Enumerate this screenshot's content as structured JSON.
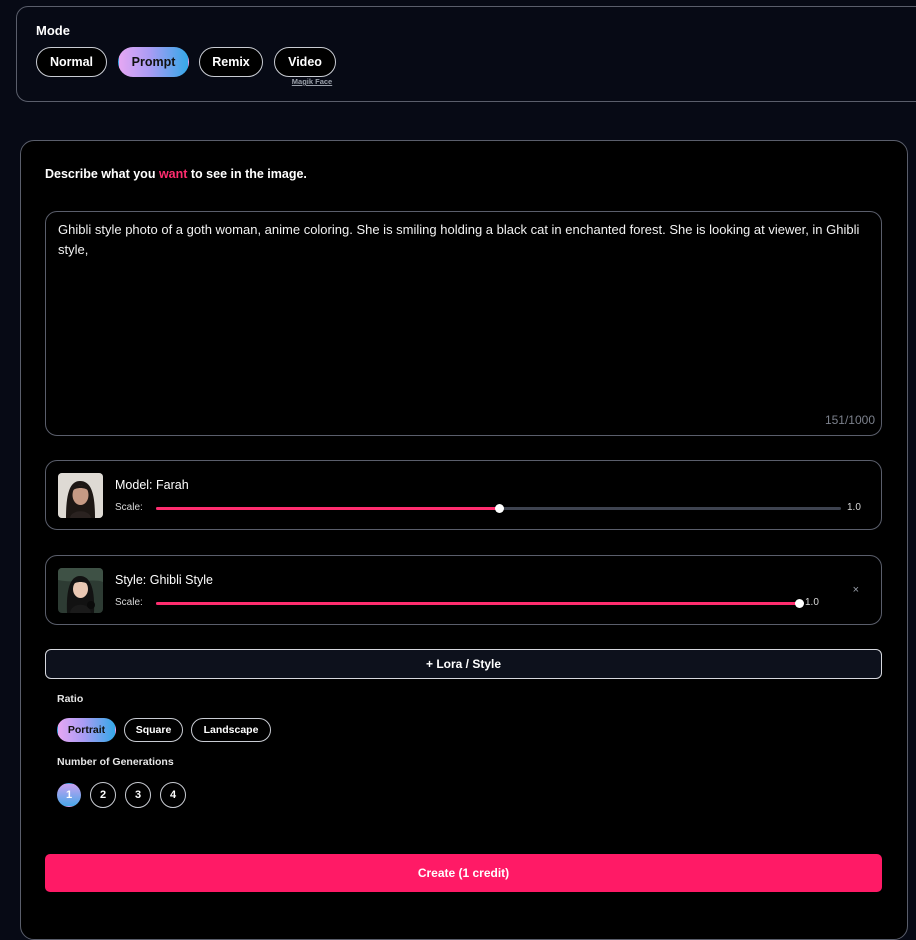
{
  "mode": {
    "title": "Mode",
    "options": [
      {
        "label": "Normal",
        "active": false
      },
      {
        "label": "Prompt",
        "active": true
      },
      {
        "label": "Remix",
        "active": false
      },
      {
        "label": "Video",
        "active": false
      }
    ],
    "video_sublabel": "Magik Face"
  },
  "prompt": {
    "heading_before": "Describe what you ",
    "heading_highlight": "want",
    "heading_after": " to see in the image.",
    "text": "Ghibli style photo of a goth woman, anime coloring. She is smiling holding a black cat in enchanted forest. She is looking at viewer, in Ghibli style,",
    "char_count": "151/1000"
  },
  "loras": [
    {
      "name": "Model: Farah",
      "scale_label": "Scale:",
      "scale_value": "1.0",
      "slider_fraction": 0.5,
      "removable": false
    },
    {
      "name": "Style: Ghibli Style",
      "scale_label": "Scale:",
      "scale_value": "1.0",
      "slider_fraction": 1.0,
      "removable": true,
      "remove_symbol": "×"
    }
  ],
  "add_lora_label": "+ Lora / Style",
  "ratio": {
    "label": "Ratio",
    "options": [
      {
        "label": "Portrait",
        "active": true
      },
      {
        "label": "Square",
        "active": false
      },
      {
        "label": "Landscape",
        "active": false
      }
    ]
  },
  "generations": {
    "label": "Number of Generations",
    "options": [
      "1",
      "2",
      "3",
      "4"
    ],
    "selected": "1"
  },
  "create_label": "Create (1 credit)",
  "colors": {
    "accent": "#ff1a66",
    "background": "#000000",
    "border": "#5a5e6b"
  }
}
